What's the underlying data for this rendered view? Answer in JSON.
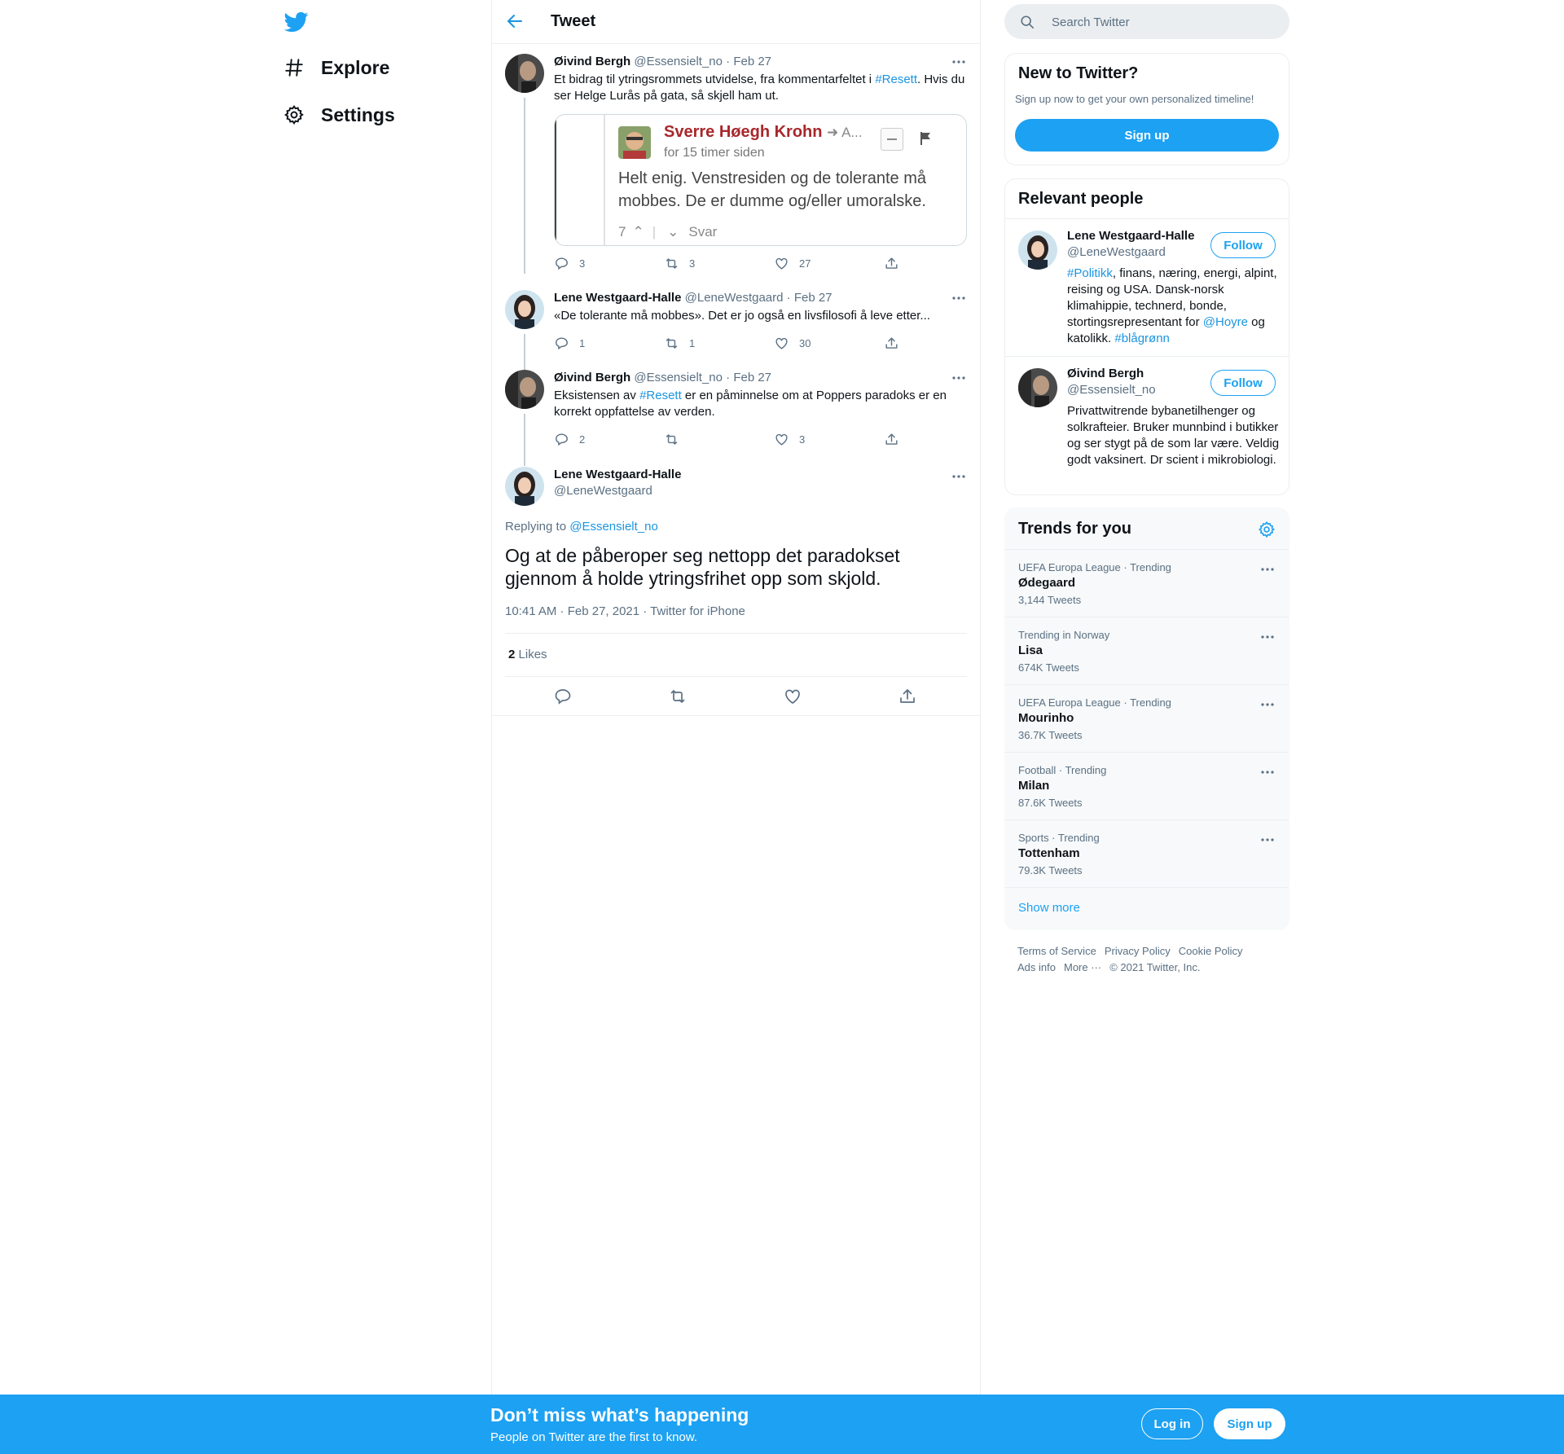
{
  "nav": {
    "items": [
      {
        "label": "Explore",
        "icon": "hashtag-icon"
      },
      {
        "label": "Settings",
        "icon": "gear-icon"
      }
    ]
  },
  "header": {
    "title": "Tweet"
  },
  "thread": [
    {
      "name": "Øivind Bergh",
      "handle": "@Essensielt_no",
      "date": "Feb 27",
      "text_parts": [
        "Et bidrag til ytringsrommets utvidelse, fra kommentarfeltet i ",
        "#Resett",
        ". Hvis du ser Helge Lurås på gata, så skjell ham ut."
      ],
      "replies": "3",
      "retweets": "3",
      "likes": "27",
      "media": {
        "author": "Sverre Høegh Krohn",
        "author_suffix": "A...",
        "time": "for 15 timer siden",
        "comment": "Helt enig. Venstresiden og de tolerante må mobbes. De er dumme og/eller umoralske.",
        "votes": "7",
        "reply_label": "Svar"
      }
    },
    {
      "name": "Lene Westgaard-Halle",
      "handle": "@LeneWestgaard",
      "date": "Feb 27",
      "text": "«De tolerante må mobbes». Det er jo også en livsfilosofi å leve etter...",
      "replies": "1",
      "retweets": "1",
      "likes": "30"
    },
    {
      "name": "Øivind Bergh",
      "handle": "@Essensielt_no",
      "date": "Feb 27",
      "text_parts": [
        "Eksistensen av ",
        "#Resett",
        " er en påminnelse om at Poppers paradoks er en korrekt oppfattelse av verden."
      ],
      "replies": "2",
      "retweets": "",
      "likes": "3"
    }
  ],
  "focus": {
    "name": "Lene Westgaard-Halle",
    "handle": "@LeneWestgaard",
    "replying_prefix": "Replying to ",
    "replying_to": "@Essensielt_no",
    "text": "Og at de påberoper seg nettopp det paradokset gjennom å holde ytringsfrihet opp som skjold.",
    "meta": "10:41 AM · Feb 27, 2021 · Twitter for iPhone",
    "likes_count": "2",
    "likes_label": "Likes"
  },
  "search": {
    "placeholder": "Search Twitter"
  },
  "signup_card": {
    "title": "New to Twitter?",
    "subtitle": "Sign up now to get your own personalized timeline!",
    "button": "Sign up"
  },
  "relevant": {
    "title": "Relevant people",
    "follow_label": "Follow",
    "people": [
      {
        "name": "Lene Westgaard-Halle",
        "handle": "@LeneWestgaard",
        "bio_parts": [
          {
            "t": "#Politikk",
            "link": true
          },
          {
            "t": ", finans, næring, energi, alpint, reising og USA. Dansk-norsk klimahippie, technerd, bonde, stortingsrepresentant for ",
            "link": false
          },
          {
            "t": "@Hoyre",
            "link": true
          },
          {
            "t": " og katolikk. ",
            "link": false
          },
          {
            "t": "#blågrønn",
            "link": true
          }
        ]
      },
      {
        "name": "Øivind Bergh",
        "handle": "@Essensielt_no",
        "bio_parts": [
          {
            "t": "Privattwitrende bybanetilhenger og solkrafteier. Bruker munnbind i butikker og ser stygt på de som lar være. Veldig godt vaksinert. Dr scient i mikrobiologi.",
            "link": false
          }
        ]
      }
    ]
  },
  "trends": {
    "title": "Trends for you",
    "items": [
      {
        "context": "UEFA Europa League · Trending",
        "name": "Ødegaard",
        "count": "3,144 Tweets"
      },
      {
        "context": "Trending in Norway",
        "name": "Lisa",
        "count": "674K Tweets"
      },
      {
        "context": "UEFA Europa League · Trending",
        "name": "Mourinho",
        "count": "36.7K Tweets"
      },
      {
        "context": "Football · Trending",
        "name": "Milan",
        "count": "87.6K Tweets"
      },
      {
        "context": "Sports · Trending",
        "name": "Tottenham",
        "count": "79.3K Tweets"
      }
    ],
    "show_more": "Show more"
  },
  "footer": {
    "links": [
      "Terms of Service",
      "Privacy Policy",
      "Cookie Policy",
      "Ads info",
      "More ···"
    ],
    "copyright": "© 2021 Twitter, Inc."
  },
  "banner": {
    "title": "Don’t miss what’s happening",
    "subtitle": "People on Twitter are the first to know.",
    "login": "Log in",
    "signup": "Sign up"
  },
  "colors": {
    "accent": "#1da1f2",
    "link": "#1b95e0",
    "muted": "#5b7083",
    "border": "#ebeef0"
  }
}
